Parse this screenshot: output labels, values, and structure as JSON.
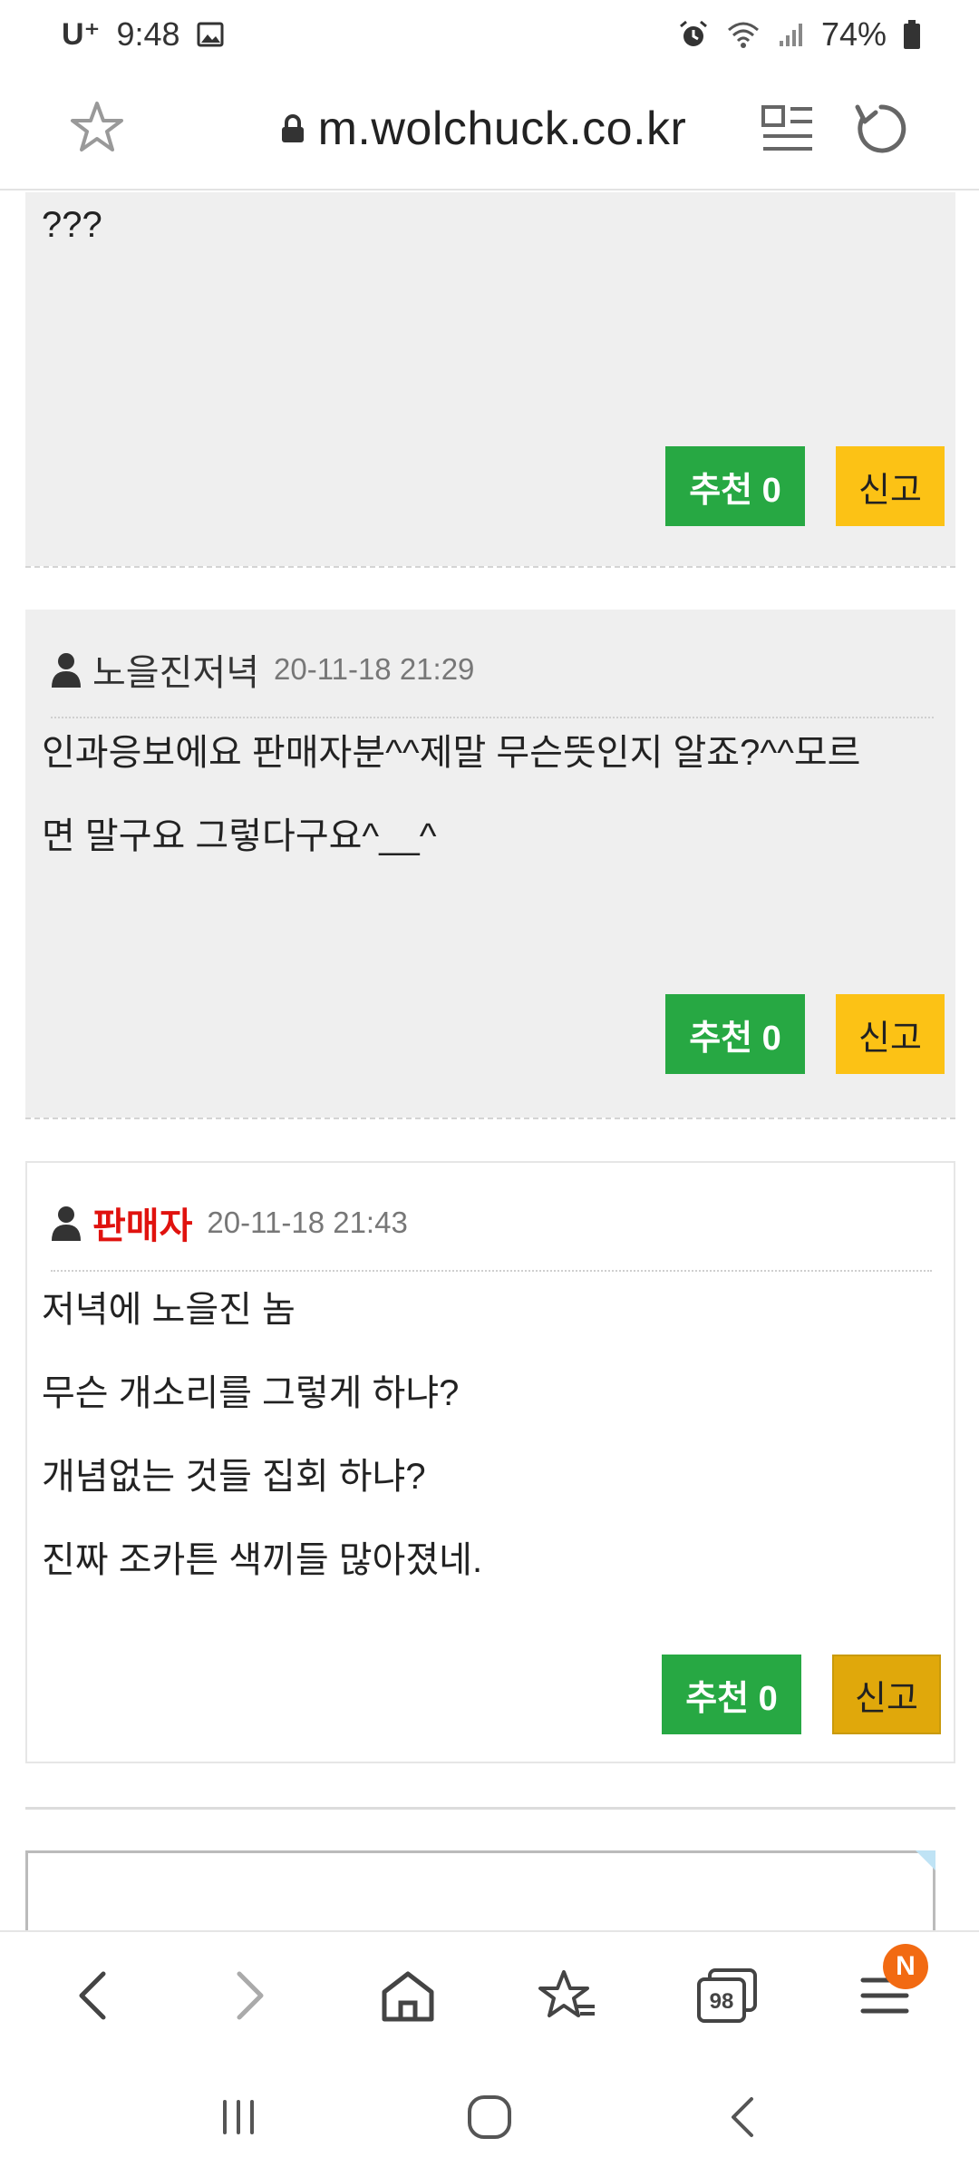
{
  "status": {
    "carrier": "U⁺",
    "time": "9:48",
    "battery": "74%"
  },
  "browser": {
    "url": "m.wolchuck.co.kr",
    "tab_count": "98",
    "menu_badge": "N"
  },
  "comments": [
    {
      "author": "",
      "date": "",
      "lines": [
        "???"
      ],
      "recommend_label": "추천 0",
      "report_label": "신고"
    },
    {
      "author": "노을진저녁",
      "date": "20-11-18 21:29",
      "lines": [
        "인과응보에요 판매자분^^제말 무슨뜻인지 알죠?^^모르",
        "면 말구요 그렇다구요^__^"
      ],
      "recommend_label": "추천 0",
      "report_label": "신고"
    },
    {
      "author": "판매자",
      "date": "20-11-18 21:43",
      "lines": [
        "저녁에 노을진 놈",
        "무슨 개소리를 그렇게 하냐?",
        "개념없는 것들 집회 하냐?",
        "진짜 조카튼 색끼들 많아졌네."
      ],
      "recommend_label": "추천 0",
      "report_label": "신고"
    }
  ],
  "colors": {
    "recommend": "#27a843",
    "report": "#fcc215",
    "seller": "#e0120e",
    "badge": "#f26a12"
  }
}
